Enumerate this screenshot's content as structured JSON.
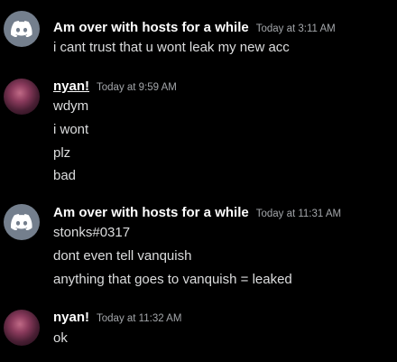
{
  "messages": [
    {
      "username": "Am over with hosts for a while",
      "timestamp": "Today at 3:11 AM",
      "lines": [
        "i cant trust that u wont leak my new acc"
      ]
    },
    {
      "username": "nyan!",
      "timestamp": "Today at 9:59 AM",
      "lines": [
        "wdym",
        "i wont",
        "plz",
        "bad"
      ]
    },
    {
      "username": "Am over with hosts for a while",
      "timestamp": "Today at 11:31 AM",
      "lines": [
        "stonks#0317",
        "dont even tell vanquish",
        "anything that goes to vanquish = leaked"
      ]
    },
    {
      "username": "nyan!",
      "timestamp": "Today at 11:32 AM",
      "lines": [
        "ok"
      ]
    }
  ],
  "colors": {
    "background": "#000000",
    "username": "#ffffff",
    "message_text": "#dcddde",
    "timestamp": "#a3a6aa",
    "discord_avatar": "#747f8d"
  },
  "icons": {
    "default_avatar": "discord-logo-icon",
    "user_avatar": "user-photo"
  }
}
